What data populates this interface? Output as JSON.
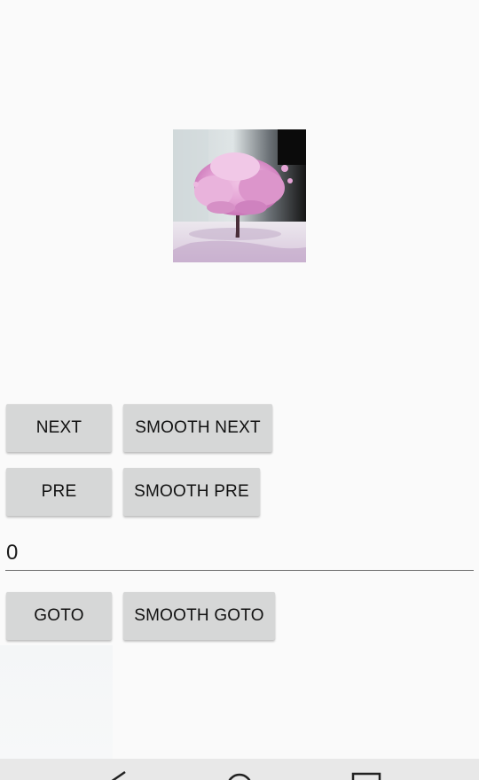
{
  "image": {
    "icon": "cherry-blossom-tree-image",
    "colors": {
      "blossom": "#e6a7d8",
      "sky_left": "#cfd6d8",
      "sky_right": "#151515",
      "ground": "#ece8ee"
    }
  },
  "controls": {
    "next_label": "NEXT",
    "smooth_next_label": "SMOOTH NEXT",
    "pre_label": "PRE",
    "smooth_pre_label": "SMOOTH PRE",
    "goto_label": "GOTO",
    "smooth_goto_label": "SMOOTH GOTO"
  },
  "page_input": {
    "value": "0"
  },
  "navbar": {
    "icons": [
      "back-icon",
      "home-icon",
      "recents-icon"
    ],
    "background": "#e8e8e8"
  },
  "theme": {
    "background": "#fafafa",
    "button": "#d6d7d7"
  }
}
